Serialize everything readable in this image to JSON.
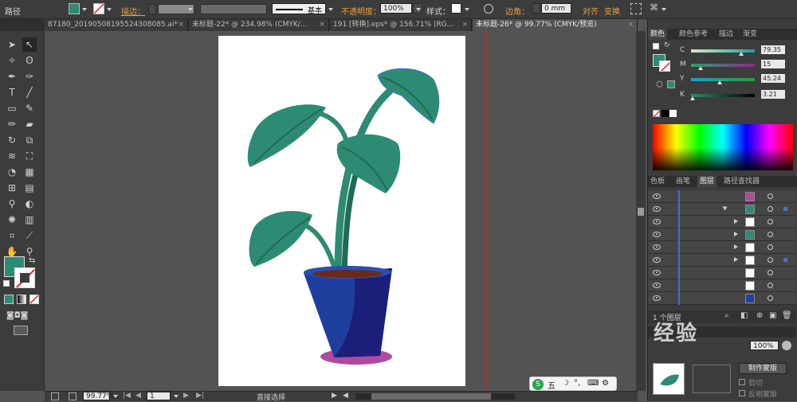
{
  "control_bar": {
    "object_type": "路径",
    "stroke_label": "描边：",
    "stroke_style": "基本",
    "opacity_label": "不透明度：",
    "opacity_value": "100%",
    "style_label": "样式：",
    "corner_label": "边角：",
    "corner_value": "0 mm",
    "align_label": "对齐",
    "transform_label": "变换"
  },
  "tabs": [
    {
      "label": "87180_20190508195524308085.ai*",
      "active": false
    },
    {
      "label": "未标题-22* @ 234.98% (CMYK/...",
      "active": false
    },
    {
      "label": "191 [转换].eps* @ 156.71% (RG...",
      "active": false
    },
    {
      "label": "未标题-26* @ 99.77% (CMYK/预览)",
      "active": true
    }
  ],
  "status_bar": {
    "zoom": "99.77%",
    "page": "1",
    "tool_name": "直接选择"
  },
  "color_panel": {
    "tabs": [
      "颜色",
      "颜色参考",
      "描边",
      "渐变"
    ],
    "channels": [
      {
        "label": "C",
        "value": "79.35",
        "fraction": 0.79
      },
      {
        "label": "M",
        "value": "15",
        "fraction": 0.15
      },
      {
        "label": "Y",
        "value": "45.24",
        "fraction": 0.45
      },
      {
        "label": "K",
        "value": "3.21",
        "fraction": 0.03
      }
    ],
    "fill_color": "#2e8b73"
  },
  "layers_panel": {
    "tabs": [
      "色板",
      "画笔",
      "图层",
      "路径查找器"
    ],
    "footer": "1 个图层"
  },
  "transparency_panel": {
    "opacity_value": "100%",
    "make_mask": "制作蒙版",
    "clip": "剪切",
    "invert_mask": "反相蒙版"
  },
  "ime": {
    "label": "五"
  },
  "watermark": {
    "text": "经验"
  },
  "colors": {
    "leaf": "#2e8b73",
    "leaf_dark": "#1f6b57",
    "pot_blue": "#1f3f9e",
    "pot_navy": "#1b1f7a",
    "shadow": "#b04aa0",
    "soil": "#6a2a1a"
  }
}
